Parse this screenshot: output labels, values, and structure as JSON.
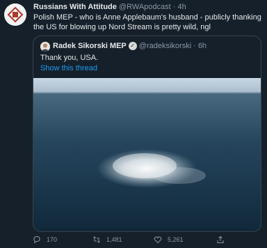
{
  "tweet": {
    "author_name": "Russians With Attitude",
    "author_handle": "@RWApodcast",
    "separator": "·",
    "time": "4h",
    "text": "Polish MEP - who is Anne Applebaum's husband - publicly thanking the US for blowing up Nord Stream is pretty wild, ngl"
  },
  "quoted": {
    "author_name": "Radek Sikorski MEP",
    "author_handle": "@radeksikorski",
    "separator": "·",
    "time": "6h",
    "text": "Thank you, USA.",
    "link_text": "Show this thread",
    "verified_icon": "verified-badge-icon"
  },
  "actions": {
    "reply_icon": "reply-icon",
    "reply_count": "170",
    "retweet_icon": "retweet-icon",
    "retweet_count": "1,481",
    "like_icon": "heart-icon",
    "like_count": "5,261",
    "share_icon": "share-icon"
  },
  "colors": {
    "background": "#15202b",
    "link": "#1d9bf0",
    "muted": "#8b98a5",
    "border": "#38444d"
  }
}
